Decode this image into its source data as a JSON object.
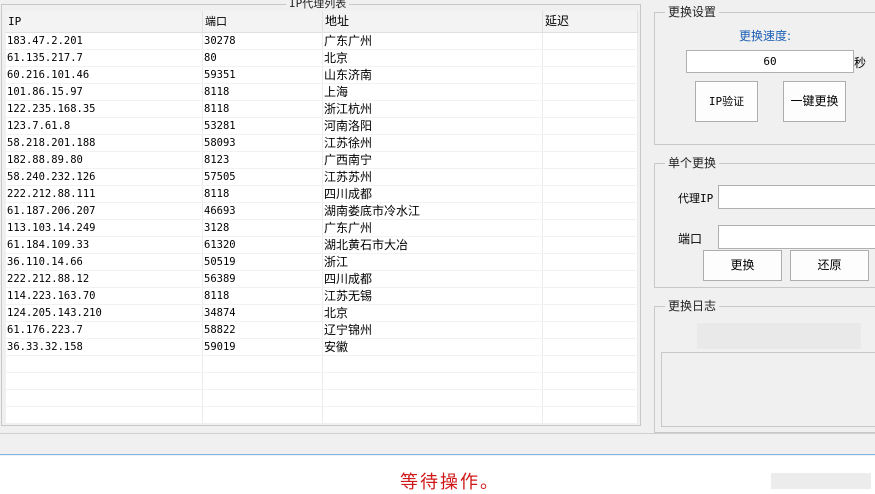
{
  "proxy_list": {
    "title": "IP代理列表",
    "columns": [
      "IP",
      "端口",
      "地址",
      "延迟"
    ],
    "rows": [
      {
        "ip": "183.47.2.201",
        "port": "30278",
        "addr": "广东广州",
        "delay": ""
      },
      {
        "ip": "61.135.217.7",
        "port": "80",
        "addr": "北京",
        "delay": ""
      },
      {
        "ip": "60.216.101.46",
        "port": "59351",
        "addr": "山东济南",
        "delay": ""
      },
      {
        "ip": "101.86.15.97",
        "port": "8118",
        "addr": "上海",
        "delay": ""
      },
      {
        "ip": "122.235.168.35",
        "port": "8118",
        "addr": "浙江杭州",
        "delay": ""
      },
      {
        "ip": "123.7.61.8",
        "port": "53281",
        "addr": "河南洛阳",
        "delay": ""
      },
      {
        "ip": "58.218.201.188",
        "port": "58093",
        "addr": "江苏徐州",
        "delay": ""
      },
      {
        "ip": "182.88.89.80",
        "port": "8123",
        "addr": "广西南宁",
        "delay": ""
      },
      {
        "ip": "58.240.232.126",
        "port": "57505",
        "addr": "江苏苏州",
        "delay": ""
      },
      {
        "ip": "222.212.88.111",
        "port": "8118",
        "addr": "四川成都",
        "delay": ""
      },
      {
        "ip": "61.187.206.207",
        "port": "46693",
        "addr": "湖南娄底市冷水江",
        "delay": ""
      },
      {
        "ip": "113.103.14.249",
        "port": "3128",
        "addr": "广东广州",
        "delay": ""
      },
      {
        "ip": "61.184.109.33",
        "port": "61320",
        "addr": "湖北黄石市大冶",
        "delay": ""
      },
      {
        "ip": "36.110.14.66",
        "port": "50519",
        "addr": "浙江",
        "delay": ""
      },
      {
        "ip": "222.212.88.12",
        "port": "56389",
        "addr": "四川成都",
        "delay": ""
      },
      {
        "ip": "114.223.163.70",
        "port": "8118",
        "addr": "江苏无锡",
        "delay": ""
      },
      {
        "ip": "124.205.143.210",
        "port": "34874",
        "addr": "北京",
        "delay": ""
      },
      {
        "ip": "61.176.223.7",
        "port": "58822",
        "addr": "辽宁锦州",
        "delay": ""
      },
      {
        "ip": "36.33.32.158",
        "port": "59019",
        "addr": "安徽",
        "delay": ""
      },
      {
        "ip": "",
        "port": "",
        "addr": "",
        "delay": ""
      },
      {
        "ip": "",
        "port": "",
        "addr": "",
        "delay": ""
      },
      {
        "ip": "",
        "port": "",
        "addr": "",
        "delay": ""
      },
      {
        "ip": "",
        "port": "",
        "addr": "",
        "delay": ""
      },
      {
        "ip": "",
        "port": "",
        "addr": "",
        "delay": ""
      }
    ]
  },
  "settings": {
    "title": "更换设置",
    "speed_label": "更换速度:",
    "speed_value": "60",
    "speed_unit": "秒",
    "verify_button": "IP验证",
    "one_click_button": "一键更换"
  },
  "single_change": {
    "title": "单个更换",
    "proxy_ip_label": "代理IP",
    "proxy_ip_value": "",
    "port_label": "端口",
    "port_value": "",
    "change_button": "更换",
    "restore_button": "还原"
  },
  "log": {
    "title": "更换日志"
  },
  "status": {
    "text": "等待操作。",
    "color": "#d01818"
  }
}
